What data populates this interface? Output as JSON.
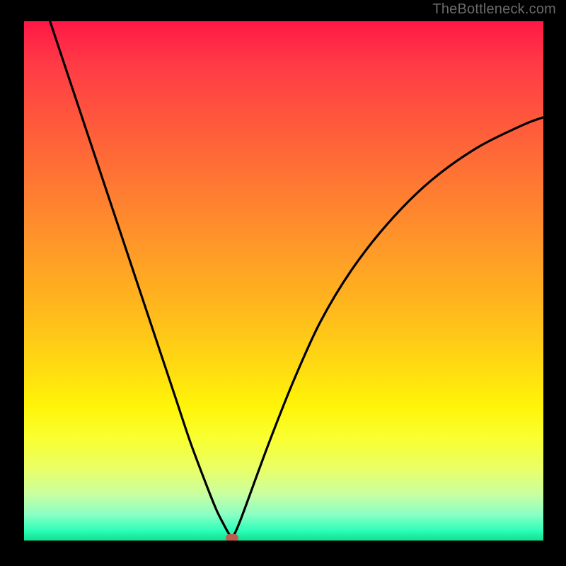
{
  "watermark": "TheBottleneck.com",
  "chart_data": {
    "type": "line",
    "title": "",
    "xlabel": "",
    "ylabel": "",
    "xlim": [
      0,
      1
    ],
    "ylim": [
      0,
      1
    ],
    "series": [
      {
        "name": "bottleneck-curve",
        "x": [
          0.05,
          0.09,
          0.13,
          0.17,
          0.21,
          0.25,
          0.29,
          0.32,
          0.35,
          0.37,
          0.385,
          0.395,
          0.4,
          0.405,
          0.415,
          0.43,
          0.45,
          0.48,
          0.52,
          0.57,
          0.63,
          0.7,
          0.78,
          0.87,
          0.96,
          1.0
        ],
        "y": [
          1.0,
          0.88,
          0.76,
          0.64,
          0.52,
          0.4,
          0.28,
          0.19,
          0.11,
          0.06,
          0.03,
          0.012,
          0.005,
          0.012,
          0.035,
          0.075,
          0.13,
          0.21,
          0.31,
          0.42,
          0.52,
          0.61,
          0.69,
          0.755,
          0.8,
          0.815
        ]
      }
    ],
    "marker": {
      "x": 0.4,
      "y": 0.005,
      "color": "#c25a4f"
    },
    "gradient_stops": [
      {
        "pos": 0.0,
        "color": "#ff1846"
      },
      {
        "pos": 0.5,
        "color": "#ffba1c"
      },
      {
        "pos": 0.8,
        "color": "#faff2e"
      },
      {
        "pos": 1.0,
        "color": "#10e090"
      }
    ]
  }
}
